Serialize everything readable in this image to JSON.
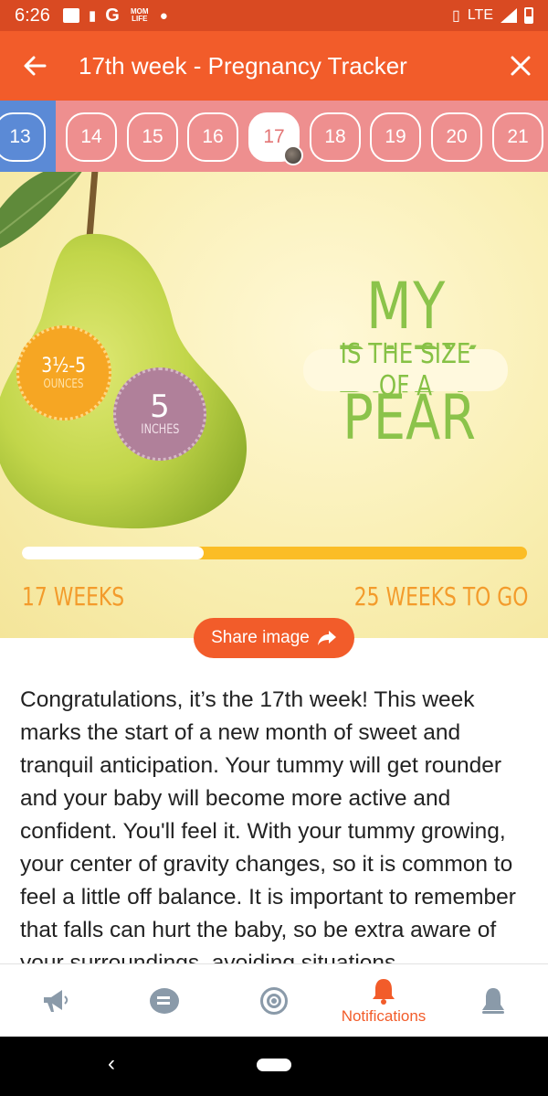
{
  "status_bar": {
    "time": "6:26",
    "mom_life": "MOM LIFE",
    "network": "LTE"
  },
  "app_bar": {
    "title": "17th week - Pregnancy Tracker",
    "back_icon": "arrow-left-icon",
    "close_icon": "close-icon"
  },
  "weeks": {
    "items": [
      "13",
      "14",
      "15",
      "16",
      "17",
      "18",
      "19",
      "20",
      "21"
    ],
    "selected": "17"
  },
  "hero": {
    "line1": "MY BABY",
    "line2": "IS THE SIZE OF A",
    "line3": "PEAR",
    "weight_value": "3½-5",
    "weight_unit": "OUNCES",
    "length_value": "5",
    "length_unit": "INCHES",
    "progress_fraction": 0.36,
    "weeks_done": "17 WEEKS",
    "weeks_left": "25 WEEKS TO GO"
  },
  "share": {
    "label": "Share image"
  },
  "article": {
    "text": "Congratulations, it’s the 17th week! This week marks the start of a new month of sweet and tranquil anticipation. Your tummy will get rounder and your baby will become more active and confident. You'll feel it. With your tummy growing, your center of gravity changes, so it is common to feel a little off balance. It is important to remember that falls can hurt the baby, so be extra aware of your surroundings, avoiding situations"
  },
  "bottom_nav": {
    "items": [
      {
        "icon": "megaphone-icon",
        "label": ""
      },
      {
        "icon": "chat-icon",
        "label": ""
      },
      {
        "icon": "target-icon",
        "label": ""
      },
      {
        "icon": "bell-icon",
        "label": "Notifications"
      },
      {
        "icon": "profile-icon",
        "label": ""
      }
    ],
    "active_color": "#f25c2a",
    "inactive_color": "#8a9aa9"
  },
  "colors": {
    "status_bar": "#d94a22",
    "app_bar": "#f25c2a",
    "week_strip": "#ee8f8f",
    "week_prev": "#5b8ad6",
    "pear_text": "#8bc34a",
    "progress": "#fbbd26"
  }
}
